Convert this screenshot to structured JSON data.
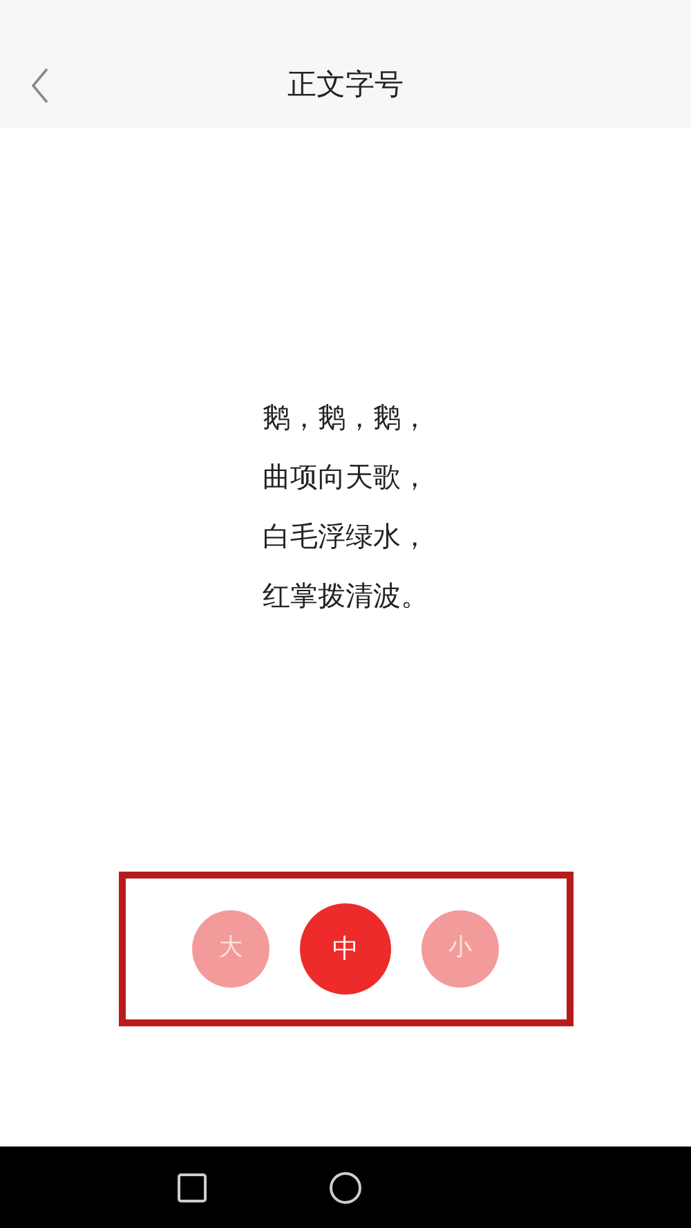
{
  "header": {
    "title": "正文字号"
  },
  "poem": [
    "鹅，鹅，鹅，",
    "曲项向天歌，",
    "白毛浮绿水，",
    "红掌拨清波。"
  ],
  "font_sizes": [
    {
      "label": "大",
      "selected": false
    },
    {
      "label": "中",
      "selected": true
    },
    {
      "label": "小",
      "selected": false
    }
  ]
}
